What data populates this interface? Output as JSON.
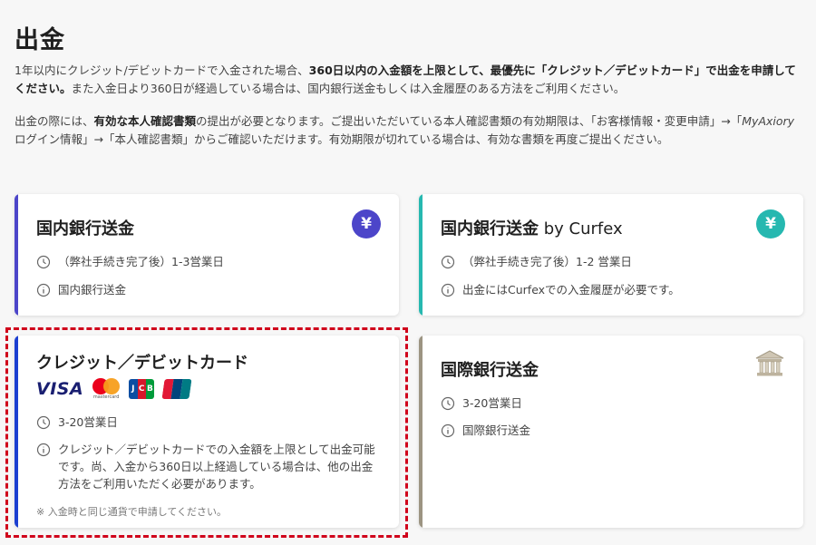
{
  "page": {
    "title": "出金",
    "intro1_a": "1年以内にクレジット/デビットカードで入金された場合、",
    "intro1_b": "360日以内の入金額を上限として、最優先に「クレジット／デビットカード」で出金を申請してください。",
    "intro1_c": "また入金日より360日が経過している場合は、国内銀行送金もしくは入金履歴のある方法をご利用ください。",
    "intro2_a": "出金の際には、",
    "intro2_b": "有効な本人確認書類",
    "intro2_c": "の提出が必要となります。ご提出いただいている本人確認書類の有効期限は、「お客様情報・変更申請」→「",
    "intro2_d": "MyAxiory",
    "intro2_e": "ログイン情報」→「本人確認書類」からご確認いただけます。有効期限が切れている場合は、有効な書類を再度ご提出ください。"
  },
  "cards": [
    {
      "title": "国内銀行送金",
      "icon": "yen-icon",
      "accent": "#4c45c9",
      "time": "（弊社手続き完了後）1-3営業日",
      "info": "国内銀行送金"
    },
    {
      "title": "国内銀行送金",
      "title_sub": " by Curfex",
      "icon": "yen-icon",
      "accent": "#26b8b0",
      "time": "（弊社手続き完了後）1-2 営業日",
      "info": "出金にはCurfexでの入金履歴が必要です。"
    },
    {
      "title": "クレジット／デビットカード",
      "accent": "#1b3fd1",
      "logos": [
        "VISA",
        "mastercard",
        "JCB",
        "UnionPay"
      ],
      "time": "3-20営業日",
      "info": "クレジット／デビットカードでの入金額を上限として出金可能です。尚、入金から360日以上経過している場合は、他の出金方法をご利用いただく必要があります。",
      "note": "※ 入金時と同じ通貨で申請してください。"
    },
    {
      "title": "国際銀行送金",
      "icon": "bank-icon",
      "accent": "#9c9482",
      "time": "3-20営業日",
      "info": "国際銀行送金"
    }
  ],
  "symbols": {
    "yen": "¥"
  },
  "colors": {
    "highlight": "#d0021b"
  }
}
